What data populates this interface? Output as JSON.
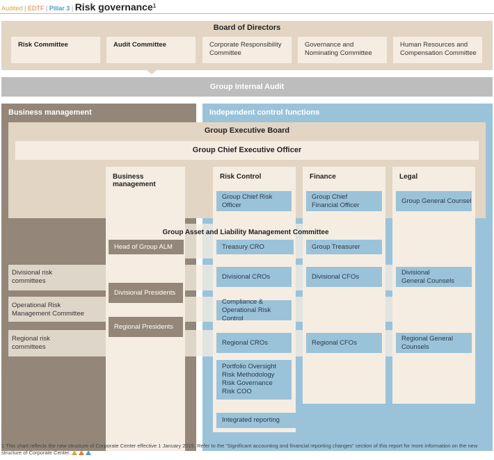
{
  "header": {
    "tag_audited": "Audited",
    "tag_edtf": "EDTF",
    "tag_pillar": "Pillar 3",
    "title": "Risk governance",
    "title_footnote_mark": "1"
  },
  "board": {
    "title": "Board of Directors",
    "committees": [
      {
        "label": "Risk Committee"
      },
      {
        "label": "Audit Committee"
      },
      {
        "label": "Corporate Responsibility\nCommittee"
      },
      {
        "label": "Governance and\nNominating Committee"
      },
      {
        "label": "Human Resources and\nCompensation Committee"
      }
    ]
  },
  "internal_audit": "Group Internal Audit",
  "business_management_title": "Business management",
  "independent_control_title": "Independent control functions",
  "executive_board": "Group Executive Board",
  "ceo": "Group Chief Executive Officer",
  "columns": {
    "business": "Business management",
    "risk": "Risk Control",
    "finance": "Finance",
    "legal": "Legal"
  },
  "officers": {
    "cro": "Group Chief Risk Officer",
    "cfo": "Group Chief\nFinancial Officer",
    "gc": "Group General Counsel"
  },
  "alm": {
    "title": "Group Asset and Liability Management Committee",
    "head": "Head of Group ALM",
    "treasury_cro": "Treasury CRO",
    "treasurer": "Group Treasurer"
  },
  "rows": {
    "divisional_label": "Divisional risk\ncommittees",
    "divisional_presidents": "Divisional Presidents",
    "divisional_cros": "Divisional CROs",
    "divisional_cfos": "Divisional CFOs",
    "divisional_gcs": "Divisional\nGeneral Counsels",
    "oprisk_label": "Operational Risk\nManagement Committee",
    "compliance": "Compliance &\nOperational Risk Control",
    "regional_presidents": "Regional Presidents",
    "regional_label": "Regional risk\ncommittees",
    "regional_cros": "Regional CROs",
    "regional_cfos": "Regional CFOs",
    "regional_gcs": "Regional General Counsels"
  },
  "portfolio": "Portfolio Oversight\nRisk Methodology\nRisk Governance\nRisk COO",
  "integrated_reporting": "Integrated reporting",
  "footnote": "1  This chart reflects the new structure of Corporate Center effective 1 January 2015. Refer to the “Significant accounting and financial reporting changes” section of this report for more information on the new structure of Corporate Center.",
  "colors": {
    "taupe": "#948678",
    "sand": "#e3d5c4",
    "cream": "#f5ede2",
    "blue": "#9ac3da",
    "grey": "#bdbdbd"
  }
}
